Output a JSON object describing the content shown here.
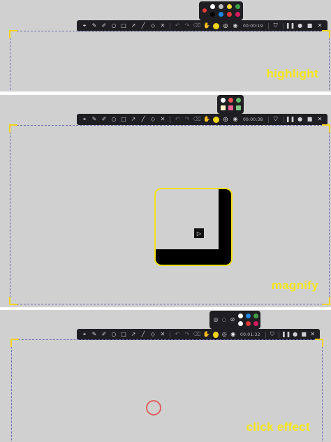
{
  "colors": {
    "panel_bg": "#d0d0d0",
    "toolbar_bg": "#1f1f23",
    "accent_yellow": "#f2d41a",
    "caption_yellow": "#f6e617",
    "click_ring": "#e06060",
    "capture_border": "#6a6ab8"
  },
  "toolbar_icons": {
    "left_group": [
      "cursor-icon",
      "pen-icon",
      "marker-icon",
      "ellipse-icon",
      "rectangle-icon",
      "arrow-icon",
      "line-icon",
      "eraser-icon",
      "crop-icon"
    ],
    "edit_group": [
      "undo-icon",
      "redo-icon",
      "clear-icon",
      "hand-icon"
    ],
    "effect_group": [
      "highlight-dot",
      "magnify-icon",
      "click-effect-icon"
    ],
    "right_group": [
      "pin-icon",
      "pause-icon",
      "record-icon",
      "stop-icon",
      "close-icon"
    ]
  },
  "panels": [
    {
      "caption": "highlight",
      "timer": "00:00:19",
      "popup": {
        "type": "color-palette",
        "colors": [
          "#e53935",
          "#ffffff",
          "#fdd835",
          "#43a047",
          "#000000",
          "#1e88e5",
          "#e53935",
          "#d81b60"
        ]
      }
    },
    {
      "caption": "magnify",
      "timer": "00:00:38",
      "popup": {
        "type": "magnify-size",
        "colors": [
          "#ffffff",
          "#ef5350",
          "#66bb6a",
          "#fff3c4",
          "#f06292",
          "#81c784"
        ]
      }
    },
    {
      "caption": "click effect",
      "timer": "00:01:32",
      "popup": {
        "type": "click-effect-palette",
        "colors": [
          "#ffffff",
          "#1e88e5",
          "#43a047",
          "#ffffff",
          "#e53935",
          "#d81b60"
        ]
      }
    }
  ]
}
